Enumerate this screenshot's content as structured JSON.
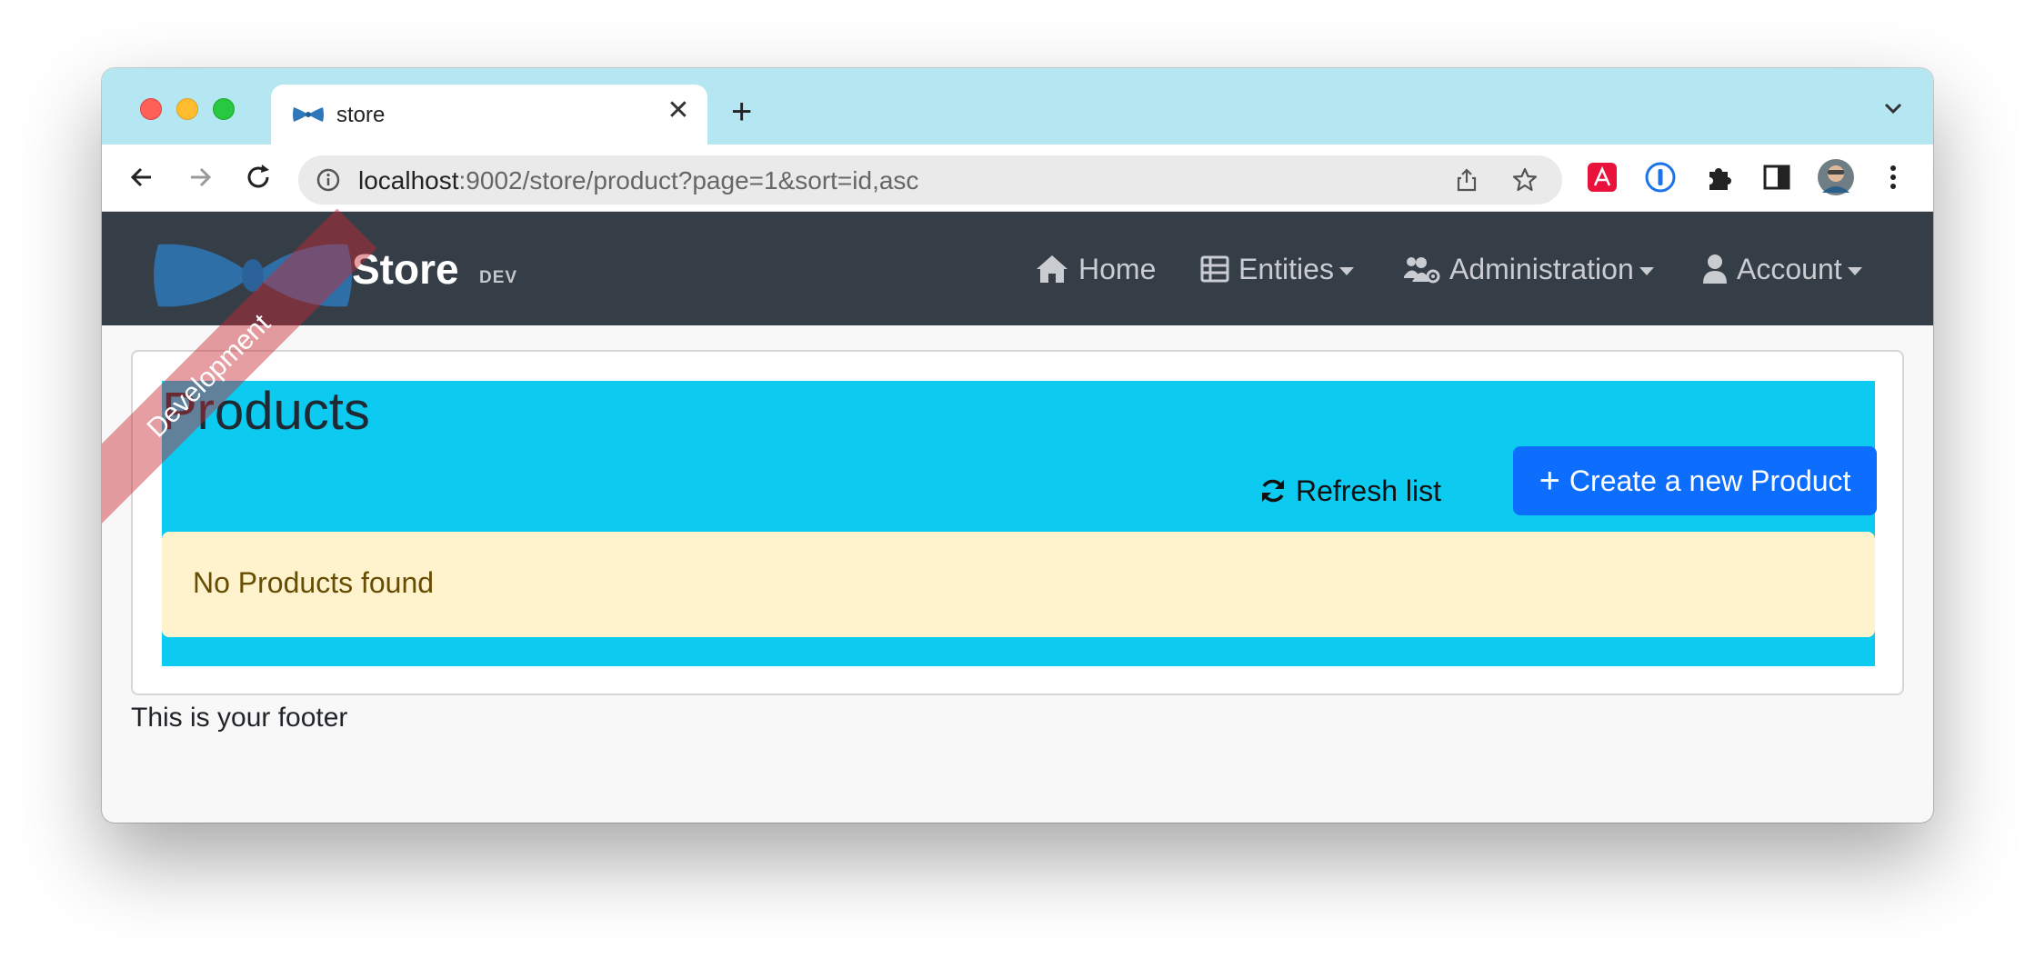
{
  "browser": {
    "tab_title": "store",
    "tab_close": "✕",
    "new_tab": "+",
    "url_host": "localhost",
    "url_rest": ":9002/store/product?page=1&sort=id,asc"
  },
  "navbar": {
    "brand_title": "Store",
    "brand_badge": "DEV",
    "items": [
      {
        "label": "Home",
        "icon": "home-icon"
      },
      {
        "label": "Entities",
        "icon": "table-icon"
      },
      {
        "label": "Administration",
        "icon": "users-cog-icon"
      },
      {
        "label": "Account",
        "icon": "user-icon"
      }
    ]
  },
  "ribbon": {
    "label": "Development"
  },
  "main": {
    "title": "Products",
    "refresh_label": "Refresh list",
    "create_label": "Create a new Product",
    "empty_message": "No Products found"
  },
  "footer": {
    "text": "This is your footer"
  },
  "colors": {
    "tabstrip": "#b4e7f2",
    "navbar": "#353d47",
    "primary": "#0d6efd",
    "cyan": "#0dcaf0",
    "warning_bg": "#fff3cd"
  }
}
